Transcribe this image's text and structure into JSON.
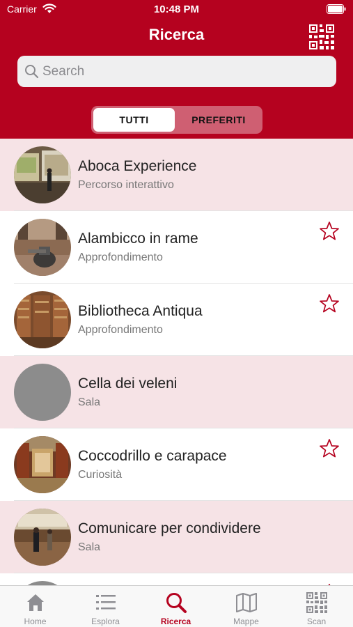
{
  "status_bar": {
    "carrier": "Carrier",
    "time": "10:48 PM"
  },
  "header": {
    "title": "Ricerca",
    "qr_icon": "qr-code-icon"
  },
  "search": {
    "placeholder": "Search",
    "value": ""
  },
  "segments": {
    "all": "TUTTI",
    "favorites": "PREFERITI",
    "selected": "TUTTI"
  },
  "colors": {
    "brand": "#b5021f",
    "highlight_row": "#f6e3e6",
    "segment_bg": "#cf5f72"
  },
  "items": [
    {
      "title": "Aboca Experience",
      "subtitle": "Percorso interattivo",
      "highlighted": true,
      "favorite_star": false
    },
    {
      "title": "Alambicco in rame",
      "subtitle": "Approfondimento",
      "highlighted": false,
      "favorite_star": true
    },
    {
      "title": "Bibliotheca Antiqua",
      "subtitle": "Approfondimento",
      "highlighted": false,
      "favorite_star": true
    },
    {
      "title": "Cella dei veleni",
      "subtitle": "Sala",
      "highlighted": true,
      "favorite_star": false
    },
    {
      "title": "Coccodrillo e carapace",
      "subtitle": "Curiosità",
      "highlighted": false,
      "favorite_star": true
    },
    {
      "title": "Comunicare per condividere",
      "subtitle": "Sala",
      "highlighted": true,
      "favorite_star": false
    }
  ],
  "tabbar": [
    {
      "label": "Home",
      "icon": "home-icon",
      "active": false
    },
    {
      "label": "Esplora",
      "icon": "list-icon",
      "active": false
    },
    {
      "label": "Ricerca",
      "icon": "search-icon",
      "active": true
    },
    {
      "label": "Mappe",
      "icon": "map-icon",
      "active": false
    },
    {
      "label": "Scan",
      "icon": "qr-code-icon",
      "active": false
    }
  ]
}
